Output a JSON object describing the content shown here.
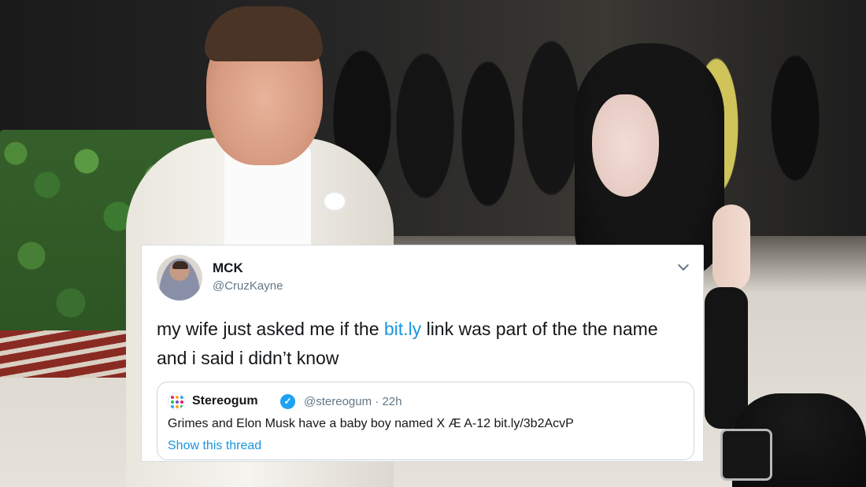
{
  "tweet": {
    "user": {
      "display_name": "MCK",
      "handle": "@CruzKayne"
    },
    "text_before_link": "my wife just asked me if the ",
    "link_text": "bit.ly",
    "text_after_link": " link was part of the the name and i said i didn’t know",
    "menu_icon": "chevron-down-icon",
    "quoted_tweet": {
      "display_name": "Stereogum",
      "verified_icon": "verified-badge-icon",
      "handle": "@stereogum",
      "separator": "·",
      "time": "22h",
      "text": "Grimes and Elon Musk have a baby boy named X Æ A-12 bit.ly/3b2AcvP",
      "show_thread": "Show this thread"
    }
  },
  "colors": {
    "link_blue": "#1b95e0",
    "verified_blue": "#1da1f2",
    "handle_gray": "#657786",
    "card_border": "#ccd6dd"
  }
}
